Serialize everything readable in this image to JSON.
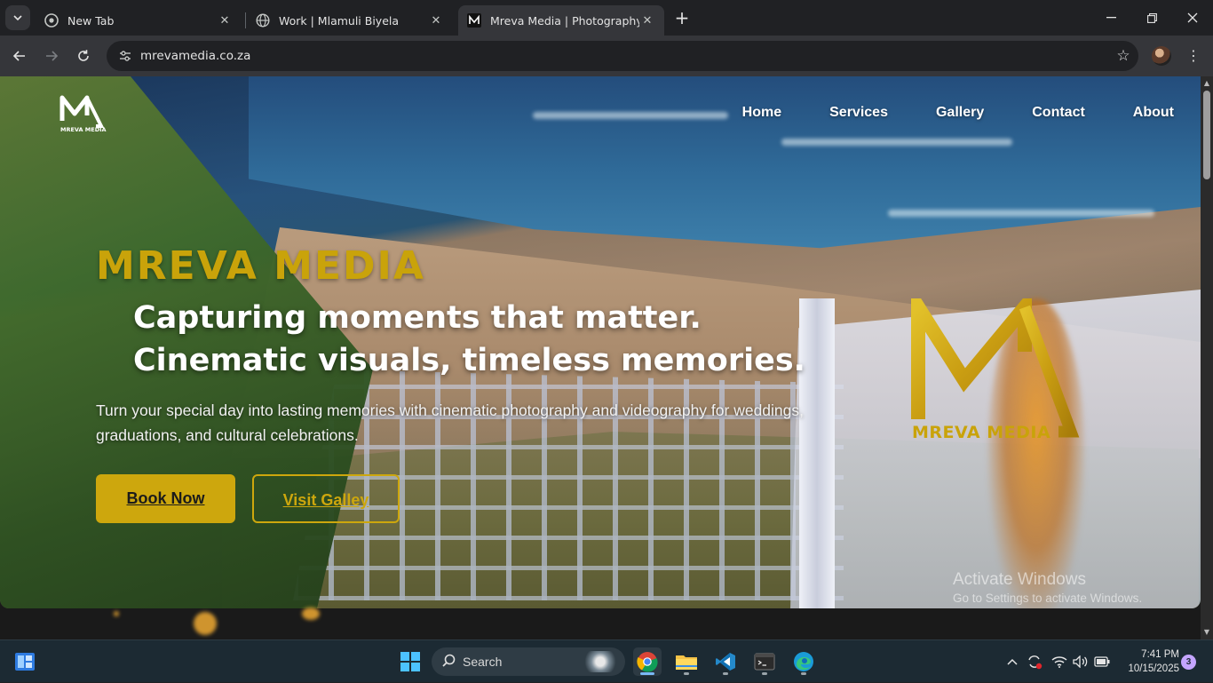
{
  "browser": {
    "tabs": [
      {
        "title": "New Tab",
        "favicon": "chrome-icon"
      },
      {
        "title": "Work | Mlamuli Biyela",
        "favicon": "globe-icon"
      },
      {
        "title": "Mreva Media | Photography, Vi",
        "favicon": "mreva-favicon",
        "active": true
      }
    ],
    "url": "mrevamedia.co.za"
  },
  "page": {
    "logo_text": "MREVA MEDIA",
    "nav": [
      "Home",
      "Services",
      "Gallery",
      "Contact",
      "About"
    ],
    "brand": "MREVA MEDIA",
    "headline_line1": "Capturing moments that matter.",
    "headline_line2": "Cinematic visuals, timeless memories.",
    "subtitle_line1": "Turn your special day into lasting memories with cinematic photography and videography for weddings,",
    "subtitle_line2": "graduations, and cultural celebrations.",
    "book_button": "Book Now",
    "gallery_button": "Visit Galley",
    "big_logo_text": "MREVA MEDIA",
    "accent_color": "#cda70d"
  },
  "watermark": {
    "line1": "Activate Windows",
    "line2": "Go to Settings to activate Windows."
  },
  "taskbar": {
    "search_label": "Search",
    "time": "7:41 PM",
    "date": "10/15/2025",
    "notification_count": "3"
  }
}
